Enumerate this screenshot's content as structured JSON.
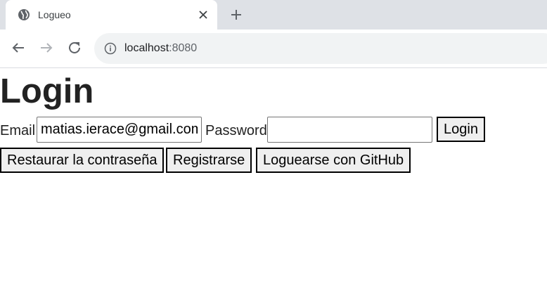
{
  "browser": {
    "tab": {
      "title": "Logueo"
    },
    "address_bar": {
      "host": "localhost",
      "port": ":8080"
    }
  },
  "page": {
    "heading": "Login",
    "form": {
      "email_label": "Email",
      "email_value": "matias.ierace@gmail.com",
      "password_label": "Password",
      "password_value": "",
      "login_button": "Login"
    },
    "actions": {
      "restore_button": "Restaurar la contraseña",
      "register_button": "Registrarse",
      "github_button": "Loguearse con GitHub"
    }
  }
}
